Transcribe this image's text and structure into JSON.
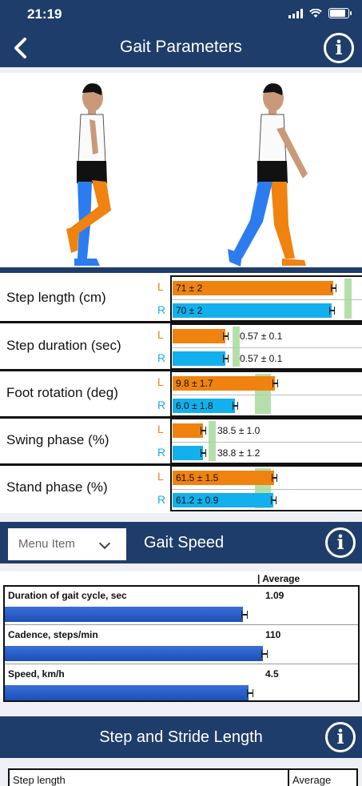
{
  "status": {
    "time": "21:19"
  },
  "header": {
    "title": "Gait Parameters"
  },
  "gait_parameters": [
    {
      "label": "Step length (cm)",
      "left": {
        "text": "71 ± 2",
        "value": 71
      },
      "right": {
        "text": "70 ± 2",
        "value": 70
      }
    },
    {
      "label": "Step duration (sec)",
      "left": {
        "text": "0.57 ± 0.1",
        "value": 0.57
      },
      "right": {
        "text": "0.57 ± 0.1",
        "value": 0.57
      }
    },
    {
      "label": "Foot rotation (deg)",
      "left": {
        "text": "9.8 ± 1.7",
        "value": 9.8
      },
      "right": {
        "text": "6.0 ± 1.8",
        "value": 6.0
      }
    },
    {
      "label": "Swing phase (%)",
      "left": {
        "text": "38.5 ± 1.0",
        "value": 38.5
      },
      "right": {
        "text": "38.8 ± 1.2",
        "value": 38.8
      }
    },
    {
      "label": "Stand phase (%)",
      "left": {
        "text": "61.5 ± 1.5",
        "value": 61.5
      },
      "right": {
        "text": "61.2 ± 0.9",
        "value": 61.2
      }
    }
  ],
  "side_labels": {
    "left": "L",
    "right": "R"
  },
  "colors": {
    "navy": "#1f3d6a",
    "left": "#f0820f",
    "right": "#12b0ec",
    "norm": "#a8d99a",
    "speed_bar": "#2a5fc8"
  },
  "gait_speed": {
    "menu_label": "Menu Item",
    "title": "Gait Speed",
    "column_header": "| Average",
    "rows": [
      {
        "label": "Duration of gait cycle, sec",
        "value": "1.09",
        "level": 1.09
      },
      {
        "label": "Cadence, steps/min",
        "value": "110",
        "level": 110
      },
      {
        "label": "Speed, km/h",
        "value": "4.5",
        "level": 4.5
      }
    ]
  },
  "stride": {
    "title": "Step and Stride Length",
    "col1": "Step length",
    "col2": "Average"
  },
  "icons": {
    "back": "chevron-left-icon",
    "info": "info-icon",
    "dropdown": "chevron-down-icon"
  }
}
